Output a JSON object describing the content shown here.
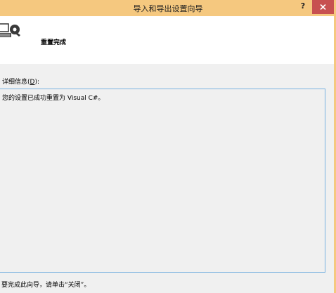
{
  "window": {
    "title": "导入和导出设置向导",
    "help_label": "?"
  },
  "header": {
    "title": "重置完成"
  },
  "details": {
    "label_prefix": "详细信息(",
    "label_mnemonic": "D",
    "label_suffix": "):",
    "text": "您的设置已成功重置为 Visual C#。"
  },
  "footer": {
    "text": "要完成此向导，请单击“关闭”。"
  },
  "icons": {
    "close": "close-icon",
    "header": "settings-wizard-icon"
  },
  "colors": {
    "titlebar": "#f5c87f",
    "close_button": "#c75050",
    "details_border": "#7ab2e0",
    "header_bg": "#ffffff",
    "body_bg": "#f0f0f0"
  }
}
